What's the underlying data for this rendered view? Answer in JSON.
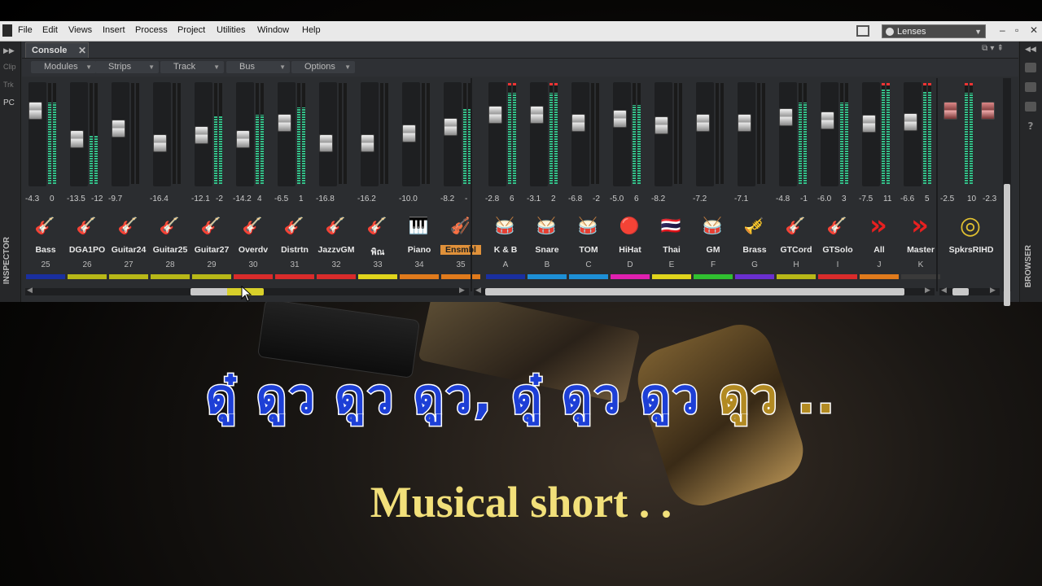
{
  "menubar": {
    "items": [
      "File",
      "Edit",
      "Views",
      "Insert",
      "Process",
      "Project",
      "Utilities",
      "Window",
      "Help"
    ],
    "lens_label": "Lenses",
    "window_buttons": [
      "–",
      "▫",
      "✕"
    ]
  },
  "left_panel": {
    "items": [
      "Clip",
      "Trk",
      "PC"
    ],
    "inspector_label": "INSPECTOR"
  },
  "right_panel": {
    "browser_label": "BROWSER"
  },
  "console": {
    "tab_label": "Console",
    "menus": [
      "Modules",
      "Strips",
      "Track",
      "Bus",
      "Options"
    ]
  },
  "strips": [
    {
      "name": "Bass",
      "num": "25",
      "vol": "-4.3",
      "pan": "0",
      "icon": "bass-guitar-icon",
      "glyph": "🎸",
      "color": "#1a2fa0",
      "fader": 0.2,
      "meter": 0.85
    },
    {
      "name": "DGA1PO",
      "num": "26",
      "vol": "-13.5",
      "pan": "-12",
      "icon": "acoustic-guitar-icon",
      "glyph": "🎸",
      "color": "#b8b818",
      "fader": 0.55,
      "meter": 0.5
    },
    {
      "name": "Guitar24",
      "num": "27",
      "vol": "-9.7",
      "pan": "",
      "icon": "acoustic-guitar-icon",
      "glyph": "🎸",
      "color": "#b8b818",
      "fader": 0.42,
      "meter": 0
    },
    {
      "name": "Guitar25",
      "num": "28",
      "vol": "-16.4",
      "pan": "",
      "icon": "acoustic-guitar-icon",
      "glyph": "🎸",
      "color": "#b8b818",
      "fader": 0.6,
      "meter": 0
    },
    {
      "name": "Guitar27",
      "num": "29",
      "vol": "-12.1",
      "pan": "-2",
      "icon": "electric-guitar-icon",
      "glyph": "🎸",
      "color": "#b8b818",
      "fader": 0.5,
      "meter": 0.7
    },
    {
      "name": "Overdv",
      "num": "30",
      "vol": "-14.2",
      "pan": "4",
      "icon": "electric-guitar-icon",
      "glyph": "🎸",
      "color": "#d92b2b",
      "fader": 0.55,
      "meter": 0.72
    },
    {
      "name": "Distrtn",
      "num": "31",
      "vol": "-6.5",
      "pan": "1",
      "icon": "electric-guitar-icon",
      "glyph": "🎸",
      "color": "#d92b2b",
      "fader": 0.35,
      "meter": 0.8
    },
    {
      "name": "JazzvGM",
      "num": "32",
      "vol": "-16.8",
      "pan": "",
      "icon": "electric-guitar-icon",
      "glyph": "🎸",
      "color": "#d92b2b",
      "fader": 0.6,
      "meter": 0
    },
    {
      "name": "พิณ",
      "num": "33",
      "vol": "-16.2",
      "pan": "",
      "icon": "lute-icon",
      "glyph": "🎸",
      "color": "#e0d41c",
      "fader": 0.6,
      "meter": 0
    },
    {
      "name": "Piano",
      "num": "34",
      "vol": "-10.0",
      "pan": "",
      "icon": "piano-icon",
      "glyph": "🎹",
      "color": "#e07a1c",
      "fader": 0.48,
      "meter": 0
    },
    {
      "name": "Ensmbl",
      "num": "35",
      "vol": "-8.2",
      "pan": "-",
      "icon": "violin-icon",
      "glyph": "🎻",
      "color": "#e07a1c",
      "fader": 0.4,
      "meter": 0.78,
      "highlight": true
    },
    {
      "name": "K & B",
      "num": "A",
      "vol": "-2.8",
      "pan": "6",
      "icon": "drum-kit-icon",
      "glyph": "🥁",
      "color": "#1a2fa0",
      "fader": 0.25,
      "meter": 0.95
    },
    {
      "name": "Snare",
      "num": "B",
      "vol": "-3.1",
      "pan": "2",
      "icon": "snare-drum-icon",
      "glyph": "🥁",
      "color": "#1d8fd6",
      "fader": 0.25,
      "meter": 0.95
    },
    {
      "name": "TOM",
      "num": "C",
      "vol": "-6.8",
      "pan": "-2",
      "icon": "tom-drum-icon",
      "glyph": "🥁",
      "color": "#1d8fd6",
      "fader": 0.35,
      "meter": 0
    },
    {
      "name": "HiHat",
      "num": "D",
      "vol": "-5.0",
      "pan": "6",
      "icon": "hihat-icon",
      "glyph": "🔴",
      "color": "#e020b0",
      "fader": 0.3,
      "meter": 0.82
    },
    {
      "name": "Thai",
      "num": "E",
      "vol": "-8.2",
      "pan": "",
      "icon": "thai-flag-icon",
      "glyph": "🇹🇭",
      "color": "#e0d41c",
      "fader": 0.38,
      "meter": 0
    },
    {
      "name": "GM",
      "num": "F",
      "vol": "-7.2",
      "pan": "",
      "icon": "cymbal-icon",
      "glyph": "🥁",
      "color": "#30c030",
      "fader": 0.35,
      "meter": 0
    },
    {
      "name": "Brass",
      "num": "G",
      "vol": "-7.1",
      "pan": "",
      "icon": "trumpet-icon",
      "glyph": "🎺",
      "color": "#6a2fd0",
      "fader": 0.35,
      "meter": 0
    },
    {
      "name": "GTCord",
      "num": "H",
      "vol": "-4.8",
      "pan": "-1",
      "icon": "electric-guitar-icon",
      "glyph": "🎸",
      "color": "#b8b818",
      "fader": 0.28,
      "meter": 0.85
    },
    {
      "name": "GTSolo",
      "num": "I",
      "vol": "-6.0",
      "pan": "3",
      "icon": "electric-guitar-icon",
      "glyph": "🎸",
      "color": "#d92b2b",
      "fader": 0.32,
      "meter": 0.85
    },
    {
      "name": "All",
      "num": "J",
      "vol": "-7.5",
      "pan": "11",
      "icon": "send-arrow-icon",
      "glyph": "»",
      "color": "#e07a1c",
      "fader": 0.36,
      "meter": 0.98
    },
    {
      "name": "Master",
      "num": "K",
      "vol": "-6.6",
      "pan": "5",
      "icon": "send-arrow-icon",
      "glyph": "»",
      "color": "#3a3a3a",
      "fader": 0.34,
      "meter": 0.96
    },
    {
      "name": "SpkrsRIHD",
      "num": "",
      "vol": "-2.5",
      "pan": "10",
      "pan2": "-2.3",
      "icon": "speaker-output-icon",
      "glyph": "◎",
      "color": "",
      "fader": 0.2,
      "meter": 0.95,
      "master": true
    }
  ],
  "lyrics": {
    "line1_blue": "ดู๋ ดูว ดูว ดูว, ดู๋ ดูว ดูว ",
    "line1_gold": "ดูว ..",
    "line2": "Musical short . ."
  }
}
